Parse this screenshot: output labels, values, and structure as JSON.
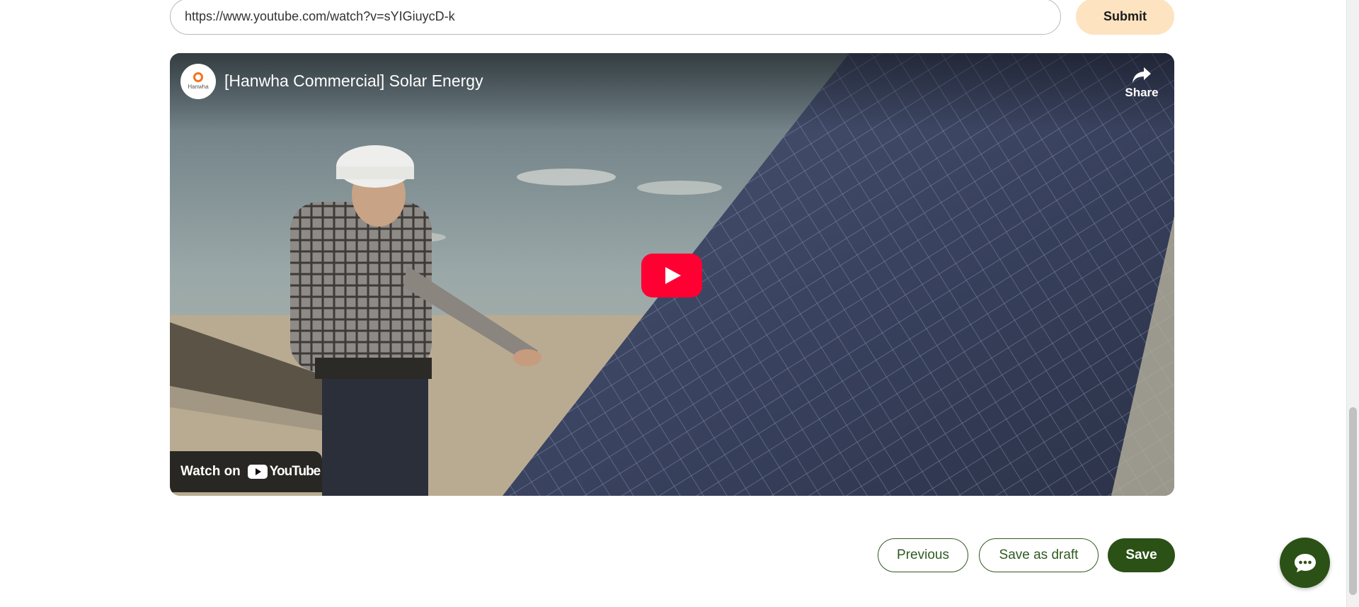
{
  "form": {
    "url_value": "https://www.youtube.com/watch?v=sYIGiuycD-k",
    "submit_label": "Submit"
  },
  "video": {
    "channel_brand": "Hanwha",
    "title": "[Hanwha Commercial] Solar Energy",
    "share_label": "Share",
    "watch_on_label": "Watch on",
    "youtube_label": "YouTube"
  },
  "actions": {
    "previous_label": "Previous",
    "draft_label": "Save as draft",
    "save_label": "Save"
  },
  "icons": {
    "share": "share-arrow-icon",
    "play": "youtube-play-icon",
    "chat": "chat-bubble-icon"
  },
  "colors": {
    "primary": "#2b5116",
    "submit_bg": "#fde3c0",
    "youtube_red": "#ff0033"
  }
}
